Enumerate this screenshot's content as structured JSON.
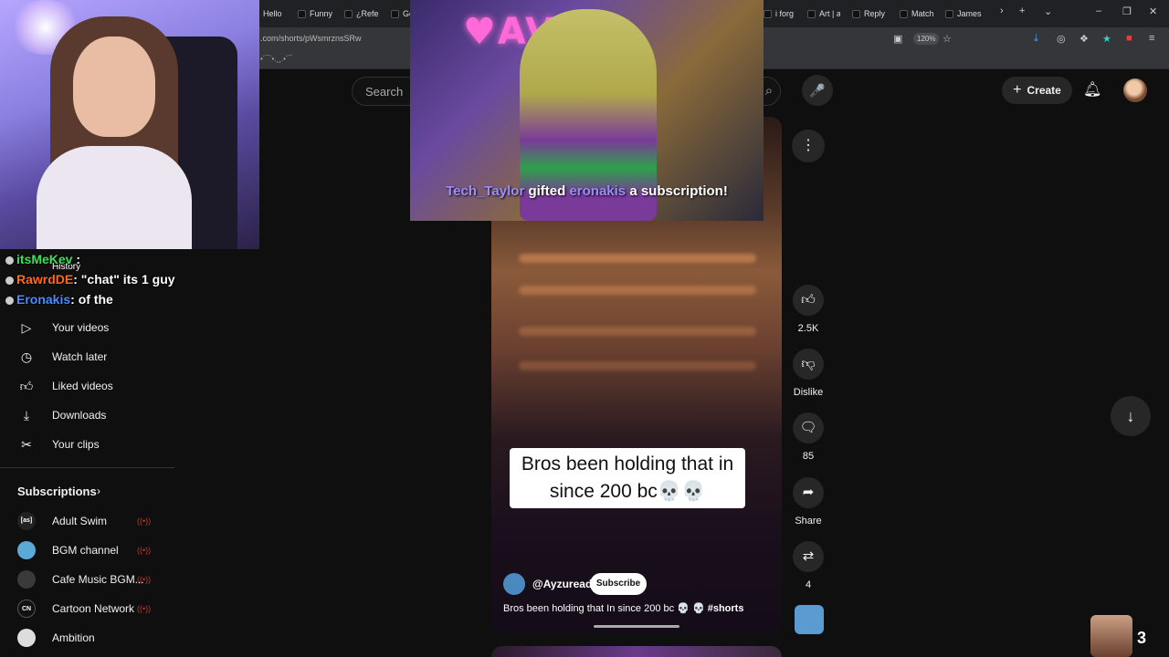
{
  "browser": {
    "tabs": [
      "Hello",
      "Funny",
      "¿Refe",
      "Ge",
      "i forg",
      "Art | a",
      "Reply",
      "Match",
      "James"
    ],
    "url": ".com/shorts/pWsmrznsSRw",
    "zoom": "120%",
    "bookmark": "•´¯`•.¸¸.•´¯"
  },
  "header": {
    "search_placeholder": "Search",
    "create_label": "Create"
  },
  "sidebar": {
    "history_label": "History",
    "items": [
      {
        "label": "Your videos",
        "icon": "play-square-icon"
      },
      {
        "label": "Watch later",
        "icon": "clock-icon"
      },
      {
        "label": "Liked videos",
        "icon": "thumbs-up-icon"
      },
      {
        "label": "Downloads",
        "icon": "download-icon"
      },
      {
        "label": "Your clips",
        "icon": "scissors-icon"
      }
    ],
    "subscriptions_title": "Subscriptions",
    "subscriptions": [
      {
        "label": "Adult Swim",
        "avatar_text": "[as]",
        "color": "#222222"
      },
      {
        "label": "BGM channel",
        "avatar_text": "",
        "color": "#5aa9d6"
      },
      {
        "label": "Cafe Music BGM...",
        "avatar_text": "",
        "color": "#3a3a3a"
      },
      {
        "label": "Cartoon Network",
        "avatar_text": "CN",
        "color": "#111111"
      },
      {
        "label": "Ambition",
        "avatar_text": "",
        "color": "#dddddd"
      }
    ]
  },
  "short": {
    "overlay_text": "Bros been holding that in since 200 bc💀💀",
    "channel": "@Ayzuread",
    "subscribe_label": "Subscribe",
    "caption": "Bros been holding that In since 200 bc 💀 💀",
    "hashtag": "#shorts"
  },
  "actions": {
    "likes": "2.5K",
    "dislike_label": "Dislike",
    "comments": "85",
    "share_label": "Share",
    "remix": "4"
  },
  "stream": {
    "alert_gifter": "Tech_Taylor",
    "alert_verb": "gifted",
    "alert_recipient": "eronakis",
    "alert_suffix": "a subscription!",
    "chat": [
      {
        "user": "itsMeKev",
        "user_color": "#3ee05a",
        "message": ":"
      },
      {
        "user": "RawrdDE",
        "user_color": "#ff6a1a",
        "message": ": \"chat\" its 1 guy"
      },
      {
        "user": "Eronakis",
        "user_color": "#4a8cff",
        "message": ": of the"
      }
    ],
    "viewer_count": "3"
  }
}
